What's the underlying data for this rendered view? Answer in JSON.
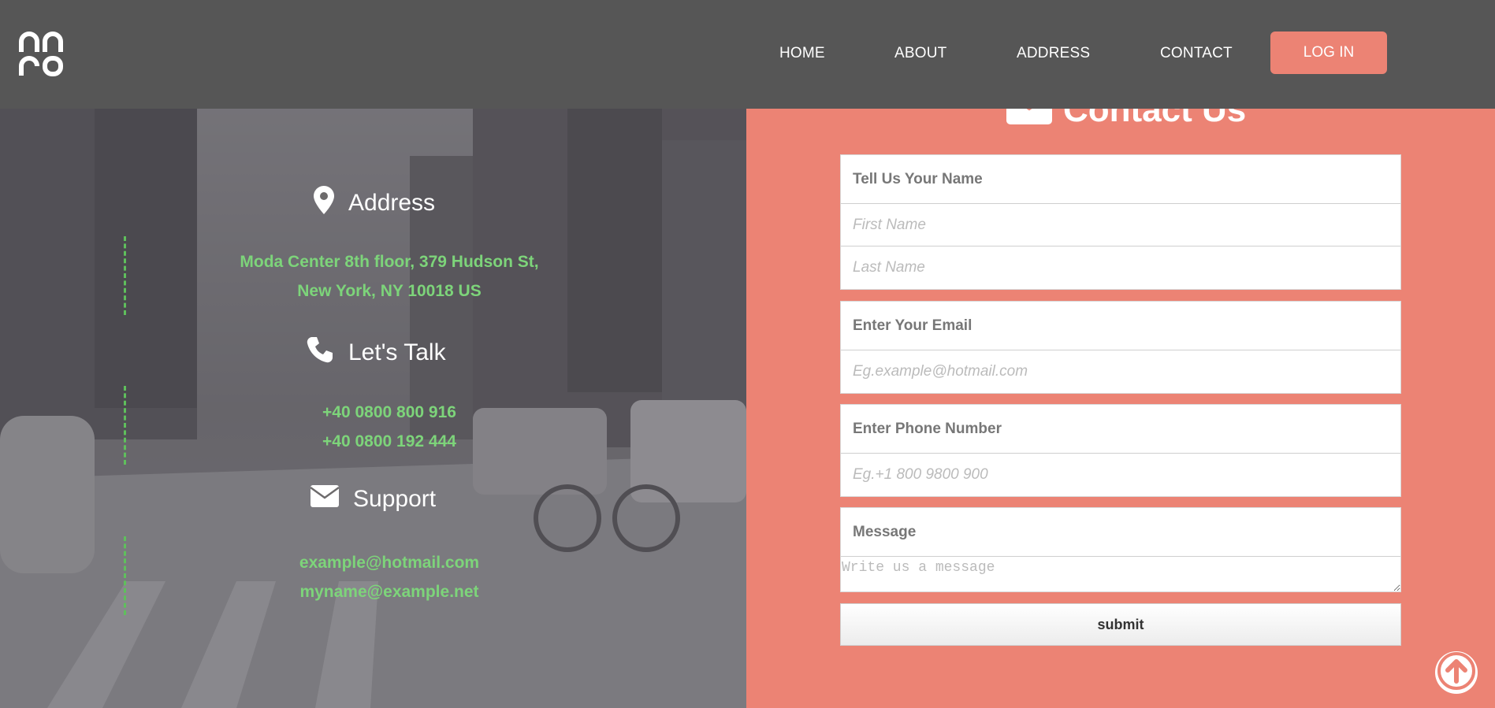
{
  "nav": {
    "items": [
      {
        "label": "HOME"
      },
      {
        "label": "ABOUT"
      },
      {
        "label": "ADDRESS"
      },
      {
        "label": "CONTACT"
      }
    ],
    "login_label": "LOG IN"
  },
  "info": {
    "address": {
      "heading": "Address",
      "line1": "Moda Center 8th floor, 379 Hudson St,",
      "line2": "New York, NY 10018 US"
    },
    "talk": {
      "heading": "Let's Talk",
      "phone1": "+40 0800 800 916",
      "phone2": "+40 0800 192 444"
    },
    "support": {
      "heading": "Support",
      "email1": "example@hotmail.com",
      "email2": "myname@example.net"
    }
  },
  "contact_form": {
    "title": "Contact Us",
    "name_label": "Tell Us Your Name",
    "first_name_placeholder": "First Name",
    "last_name_placeholder": "Last Name",
    "email_label": "Enter Your Email",
    "email_placeholder": "Eg.example@hotmail.com",
    "phone_label": "Enter Phone Number",
    "phone_placeholder": "Eg.+1 800 9800 900",
    "message_label": "Message",
    "message_placeholder": "Write us a message",
    "submit_label": "submit"
  },
  "colors": {
    "header_bg": "#565656",
    "accent": "#ec8374",
    "info_text": "#7dd47a"
  },
  "icons": [
    "logo-icon",
    "map-pin-icon",
    "phone-icon",
    "envelope-icon",
    "arrow-up-icon"
  ]
}
